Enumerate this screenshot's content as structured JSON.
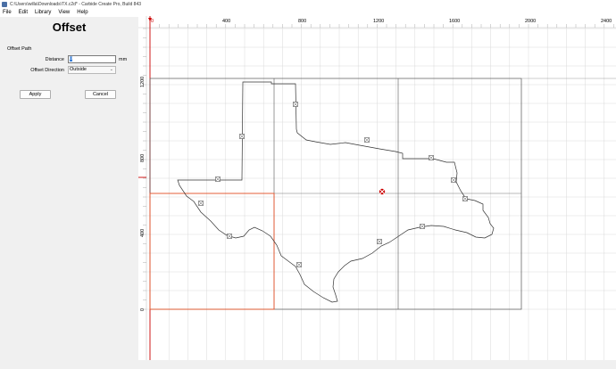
{
  "window": {
    "title": "C:\\Users\\willa\\Downloads\\TX.c2d* - Carbide Create Pro, Build 843"
  },
  "menu": [
    "File",
    "Edit",
    "Library",
    "View",
    "Help"
  ],
  "panel": {
    "title": "Offset",
    "section": "Offset Path",
    "distance_label": "Distance",
    "distance_value": "0",
    "distance_unit": "mm",
    "direction_label": "Offset Direction",
    "direction_value": "Outside",
    "apply_label": "Apply",
    "cancel_label": "Cancel"
  },
  "ruler": {
    "x_labels": [
      "0",
      "400",
      "800",
      "1200",
      "1600",
      "2000",
      "2400"
    ],
    "y_labels": [
      "1200",
      "800",
      "400",
      "0"
    ]
  },
  "colors": {
    "grid": "#d9d9d9",
    "outline": "#333333",
    "stock": "#e8542a",
    "origin": "#cc0000"
  }
}
